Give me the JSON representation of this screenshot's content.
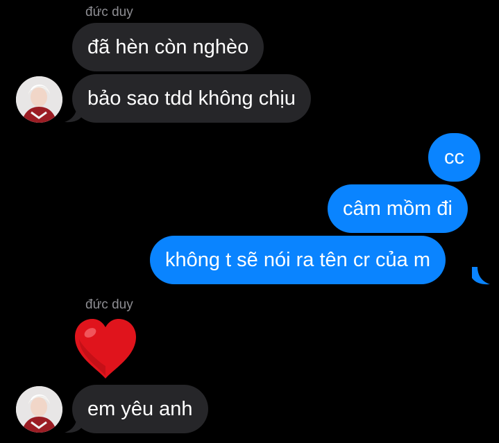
{
  "colors": {
    "background": "#000000",
    "incoming_bubble": "#262629",
    "outgoing_bubble": "#0a84ff",
    "sender_name": "#8e8e93",
    "heart": "#e0141c"
  },
  "messages": {
    "group1": {
      "sender": "đức duy",
      "line1": "đã hèn còn nghèo",
      "line2": "bảo sao tdd không chịu"
    },
    "outgoing": {
      "line1": "cc",
      "line2": "câm mồm đi",
      "line3": "không t sẽ nói ra tên cr của m"
    },
    "group2": {
      "sender": "đức duy",
      "emoji": "heart",
      "line1": "em yêu anh"
    }
  }
}
